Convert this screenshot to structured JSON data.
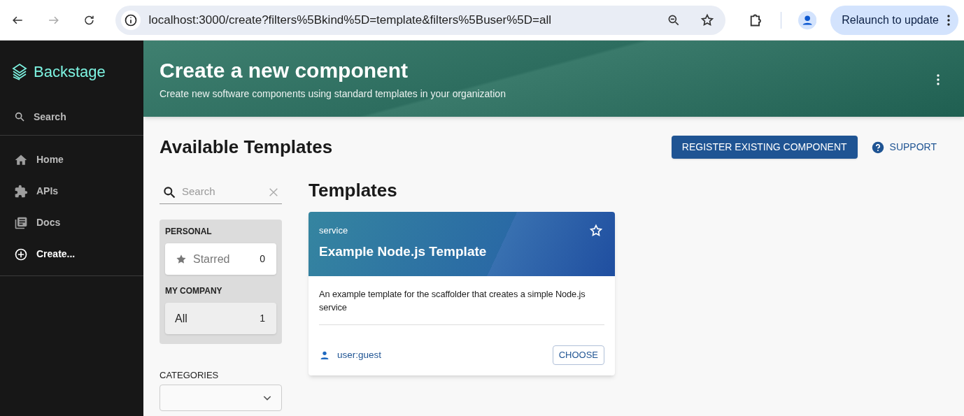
{
  "browser": {
    "url": "localhost:3000/create?filters%5Bkind%5D=template&filters%5Buser%5D=all",
    "relaunch_button": "Relaunch to update"
  },
  "sidebar": {
    "logo": "Backstage",
    "search": "Search",
    "items": [
      {
        "label": "Home",
        "kind": "home",
        "selected": false
      },
      {
        "label": "APIs",
        "kind": "apis",
        "selected": false
      },
      {
        "label": "Docs",
        "kind": "docs",
        "selected": false
      },
      {
        "label": "Create...",
        "kind": "create",
        "selected": true
      }
    ]
  },
  "header": {
    "title": "Create a new component",
    "subtitle": "Create new software components using standard templates in your organization"
  },
  "page": {
    "title": "Available Templates",
    "register_button": "REGISTER EXISTING COMPONENT",
    "support_button": "SUPPORT"
  },
  "filters": {
    "search": {
      "placeholder": "Search"
    },
    "groups": [
      {
        "label": "PERSONAL",
        "items": [
          {
            "label": "Starred",
            "count": "0",
            "kind": "starred",
            "selected": false
          }
        ]
      },
      {
        "label": "MY COMPANY",
        "items": [
          {
            "label": "All",
            "count": "1",
            "kind": "all",
            "selected": true
          }
        ]
      }
    ],
    "categories_label": "CATEGORIES"
  },
  "templates": {
    "title": "Templates",
    "cards": [
      {
        "type": "service",
        "title": "Example Node.js Template",
        "starred": false,
        "description": "An example template for the scaffolder that creates a simple Node.js service",
        "owner": "user:guest",
        "choose_button": "CHOOSE"
      }
    ]
  }
}
